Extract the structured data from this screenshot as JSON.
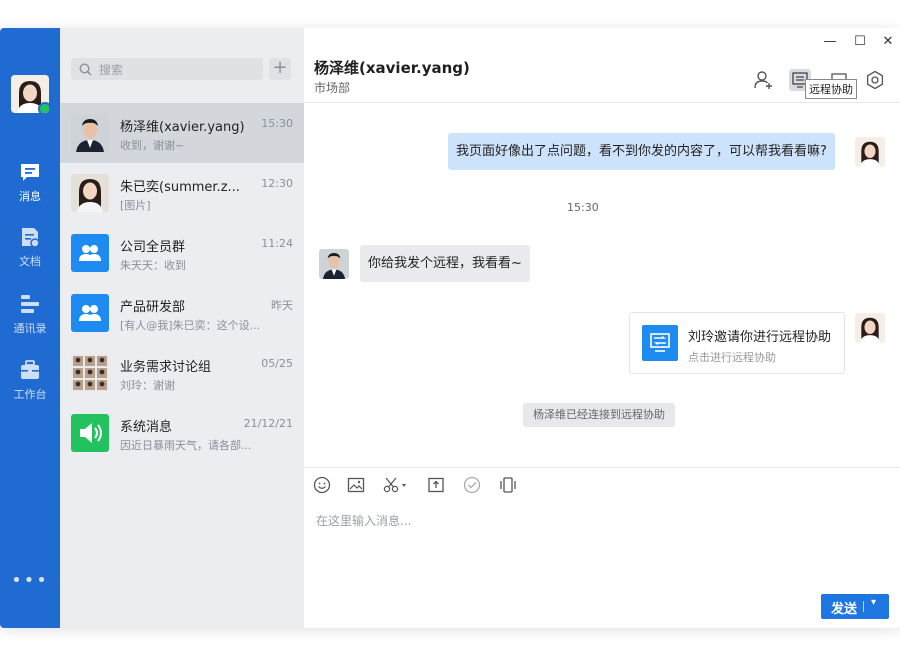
{
  "colors": {
    "rail": "#1f6bd1",
    "accent": "#1f76e0",
    "online": "#22c35e",
    "green_app": "#22c35e",
    "my_bubble": "#cde3fb"
  },
  "rail": {
    "items": [
      {
        "label": "消息",
        "icon": "chat-icon"
      },
      {
        "label": "文档",
        "icon": "document-icon"
      },
      {
        "label": "通讯录",
        "icon": "contacts-icon"
      },
      {
        "label": "工作台",
        "icon": "briefcase-icon"
      }
    ],
    "more": "•••"
  },
  "search": {
    "placeholder": "搜索",
    "add": "+"
  },
  "conversations": [
    {
      "name": "杨泽维(xavier.yang)",
      "time": "15:30",
      "preview": "收到，谢谢~"
    },
    {
      "name": "朱已奕(summer.z...",
      "time": "12:30",
      "preview": "[图片]"
    },
    {
      "name": "公司全员群",
      "time": "11:24",
      "preview": "朱天天：收到"
    },
    {
      "name": "产品研发部",
      "time": "昨天",
      "preview": "[有人@我]朱已奕：这个设..."
    },
    {
      "name": "业务需求讨论组",
      "time": "05/25",
      "preview": "刘玲：谢谢"
    },
    {
      "name": "系统消息",
      "time": "21/12/21",
      "preview": "因近日暴雨天气，请各部..."
    }
  ],
  "window_controls": {
    "minimize": "—",
    "maximize": "☐",
    "close": "✕"
  },
  "chat": {
    "title": "杨泽维(xavier.yang)",
    "department": "市场部",
    "tooltip": "远程协助",
    "messages": {
      "m1": "我页面好像出了点问题，看不到你发的内容了，可以帮我看看嘛?",
      "timestamp": "15:30",
      "m2": "你给我发个远程，我看看~",
      "card_title": "刘玲邀请你进行远程协助",
      "card_sub": "点击进行远程协助",
      "notice": "杨泽维已经连接到远程协助"
    },
    "input_placeholder": "在这里输入消息...",
    "send": "发送"
  }
}
